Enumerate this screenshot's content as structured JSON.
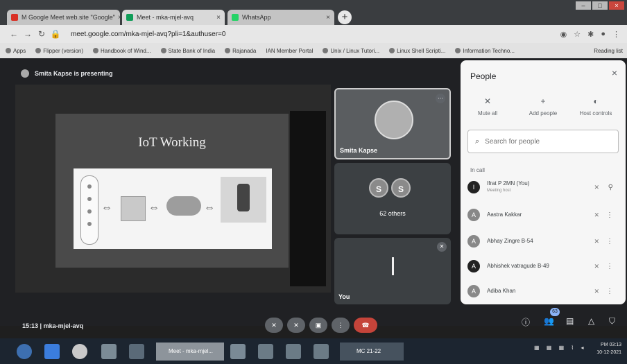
{
  "browser": {
    "tabs": [
      {
        "label": "M  Google Meet web.site \"Google\"",
        "active": false,
        "color": "#d93025"
      },
      {
        "label": "Meet - mka-mjel-avq",
        "active": true,
        "color": "#0f9d58"
      },
      {
        "label": "WhatsApp",
        "active": false,
        "color": "#25d366"
      }
    ],
    "address": "meet.google.com/mka-mjel-avq?pli=1&authuser=0",
    "bookmarks": [
      "Apps",
      "Flipper (version)",
      "Handbook of Wind...",
      "State Bank of India",
      "Rajanada",
      "IAN Member Portal",
      "Unix / Linux Tutori...",
      "Linux Shell Scripti...",
      "Information Techno...",
      "Reading list"
    ]
  },
  "meet": {
    "presenting_label": "Smita Kapse is presenting",
    "slide_title": "IoT Working",
    "tiles": {
      "presenter_name": "Smita Kapse",
      "others_initials": [
        "S",
        "S"
      ],
      "others_label": "62 others",
      "you_label": "You"
    },
    "meeting_time": "15:13",
    "meeting_code": "mka-mjel-avq",
    "participant_count": "63"
  },
  "people_panel": {
    "title": "People",
    "close": "×",
    "actions": [
      {
        "label": "Mute all",
        "icon": "mic-off-icon"
      },
      {
        "label": "Add people",
        "icon": "add-person-icon"
      },
      {
        "label": "Host controls",
        "icon": "toggle-icon"
      }
    ],
    "search_placeholder": "Search for people",
    "section_label": "In call",
    "participants": [
      {
        "initial": "I",
        "name": "Ifrat P 2MN (You)",
        "sub": "Meeting host",
        "dark": true
      },
      {
        "initial": "A",
        "name": "Aastra Kakkar",
        "sub": ""
      },
      {
        "initial": "A",
        "name": "Abhay Zingre B-54",
        "sub": ""
      },
      {
        "initial": "A",
        "name": "Abhishek vatragude B-49",
        "sub": ""
      },
      {
        "initial": "A",
        "name": "Adiba Khan",
        "sub": ""
      }
    ]
  },
  "taskbar": {
    "meet_task": "Meet - mka-mjel...",
    "mc_task": "MC 21-22",
    "time": "PM 03:13",
    "date": "10-12-2021"
  }
}
